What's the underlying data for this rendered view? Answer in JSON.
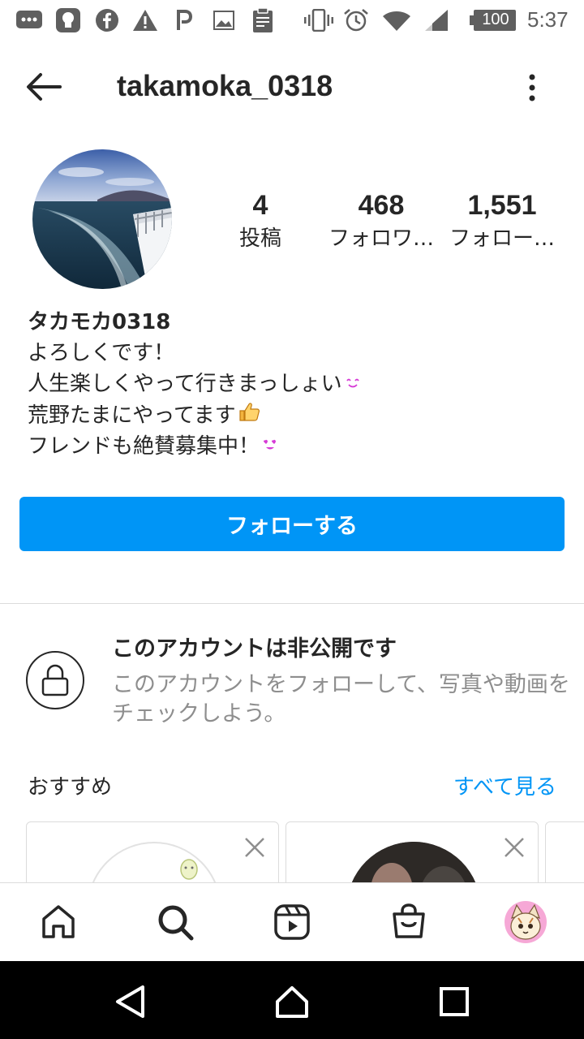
{
  "status_bar": {
    "battery": "100",
    "time": "5:37",
    "icons": [
      "message-icon",
      "notification-app-icon",
      "facebook-icon",
      "warning-icon",
      "p-app-icon",
      "image-icon",
      "clipboard-icon",
      "vibrate-icon",
      "alarm-icon",
      "wifi-icon",
      "signal-icon",
      "battery-icon"
    ]
  },
  "header": {
    "username": "takamoka_0318",
    "back_icon": "arrow-left-icon",
    "menu_icon": "more-vertical-icon"
  },
  "profile": {
    "stats": [
      {
        "value": "4",
        "label": "投稿"
      },
      {
        "value": "468",
        "label": "フォロワ…"
      },
      {
        "value": "1,551",
        "label": "フォロー…"
      }
    ],
    "bio": {
      "name": "タカモカ0318",
      "line1": "よろしくです！",
      "line2": "人生楽しくやって行きまっしょい",
      "line3": "荒野たまにやってます",
      "line4": "フレンドも絶賛募集中！"
    },
    "follow_button": "フォローする"
  },
  "private_notice": {
    "title": "このアカウントは非公開です",
    "description": "このアカウントをフォローして、写真や動画をチェックしよう。"
  },
  "suggestions": {
    "title": "おすすめ",
    "see_all": "すべて見る"
  },
  "tabs": [
    "home-icon",
    "search-icon",
    "reels-icon",
    "shop-icon",
    "profile-avatar"
  ],
  "nav": [
    "back-triangle-icon",
    "home-circle-icon",
    "recents-square-icon"
  ],
  "colors": {
    "accent": "#0095f6",
    "text": "#262626",
    "secondary_text": "#8e8e8e",
    "divider": "#dbdbdb"
  }
}
